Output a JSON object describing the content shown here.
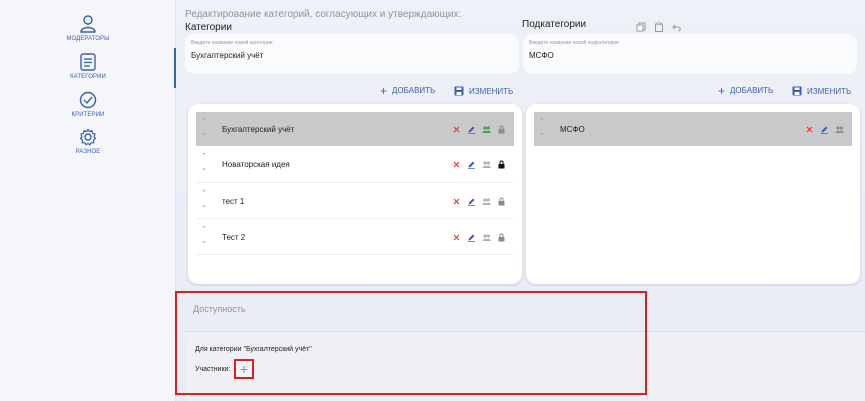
{
  "sidebar": {
    "items": [
      {
        "label": "МОДЕРАТОРЫ",
        "icon": "user-icon"
      },
      {
        "label": "КАТЕГОРИИ",
        "icon": "list-icon"
      },
      {
        "label": "КРИТЕРИИ",
        "icon": "check-circle-icon"
      },
      {
        "label": "РАЗНОЕ",
        "icon": "gear-icon"
      }
    ],
    "active": "КАТЕГОРИИ"
  },
  "header": {
    "heading": "Редактирование категорий, согласующих и утверждающих:",
    "categories_title": "Категории",
    "subcategories_title": "Подкатегории"
  },
  "category_input": {
    "placeholder": "Введите название новой категории",
    "value": "Бухгалтерский учёт"
  },
  "subcategory_input": {
    "placeholder": "Введите название новой подкатегории",
    "value": "МСФО"
  },
  "actions": {
    "add_label": "ДОБАВИТЬ",
    "edit_label": "ИЗМЕНИТЬ"
  },
  "categories": [
    {
      "name": "Бухгалтерский учёт",
      "selected": true
    },
    {
      "name": "Новаторская идея",
      "selected": false
    },
    {
      "name": "тест 1",
      "selected": false
    },
    {
      "name": "Тест 2",
      "selected": false
    }
  ],
  "subcategories": [
    {
      "name": "МСФО",
      "selected": true
    }
  ],
  "availability": {
    "title": "Доступность",
    "for_category": "Для категории \"Бухгалтерский учёт\"",
    "members_label": "Участники:",
    "add_symbol": "+"
  },
  "colors": {
    "accent": "#3a5fb5",
    "delete": "#e53935",
    "highlight": "#e31c1c",
    "selected_row": "#c9c9cb"
  }
}
